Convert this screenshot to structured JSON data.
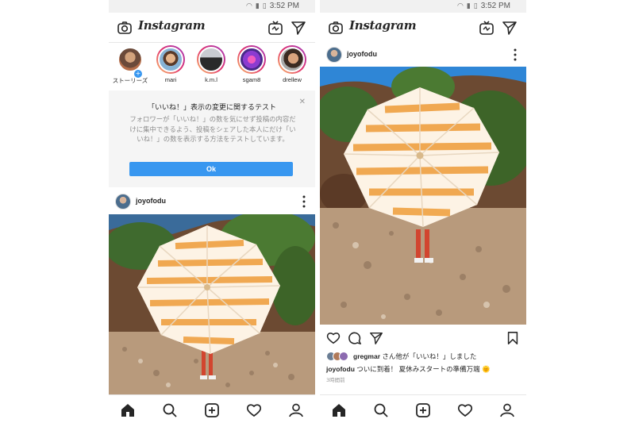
{
  "status_bar": {
    "time": "3:52 PM",
    "icons": [
      "wifi-icon",
      "signal-icon",
      "battery-icon"
    ]
  },
  "app": {
    "title": "Instagram"
  },
  "stories": [
    {
      "label": "ストーリーズ",
      "own": true
    },
    {
      "label": "mari"
    },
    {
      "label": "k.m.l"
    },
    {
      "label": "sgam8"
    },
    {
      "label": "drellew"
    }
  ],
  "notice": {
    "title": "「いいね！」表示の変更に関するテスト",
    "body": "フォロワーが「いいね！」の数を気にせず投稿の内容だけに集中できるよう、投稿をシェアした本人にだけ「いいね！」の数を表示する方法をテストしています。",
    "ok_label": "Ok"
  },
  "post": {
    "username": "joyofodu",
    "likes_user": "gregmar",
    "likes_suffix": "さん他が「いいね！」しました",
    "caption_user": "joyofodu",
    "caption_text": "ついに到着！ 夏休みスタートの準備万端 🌞",
    "timestamp": "3時間前"
  },
  "colors": {
    "accent": "#3897f0",
    "umbrella_stripe": "#f0a54a",
    "sky": "#2f86d6",
    "gravel": "#b89a7c"
  }
}
